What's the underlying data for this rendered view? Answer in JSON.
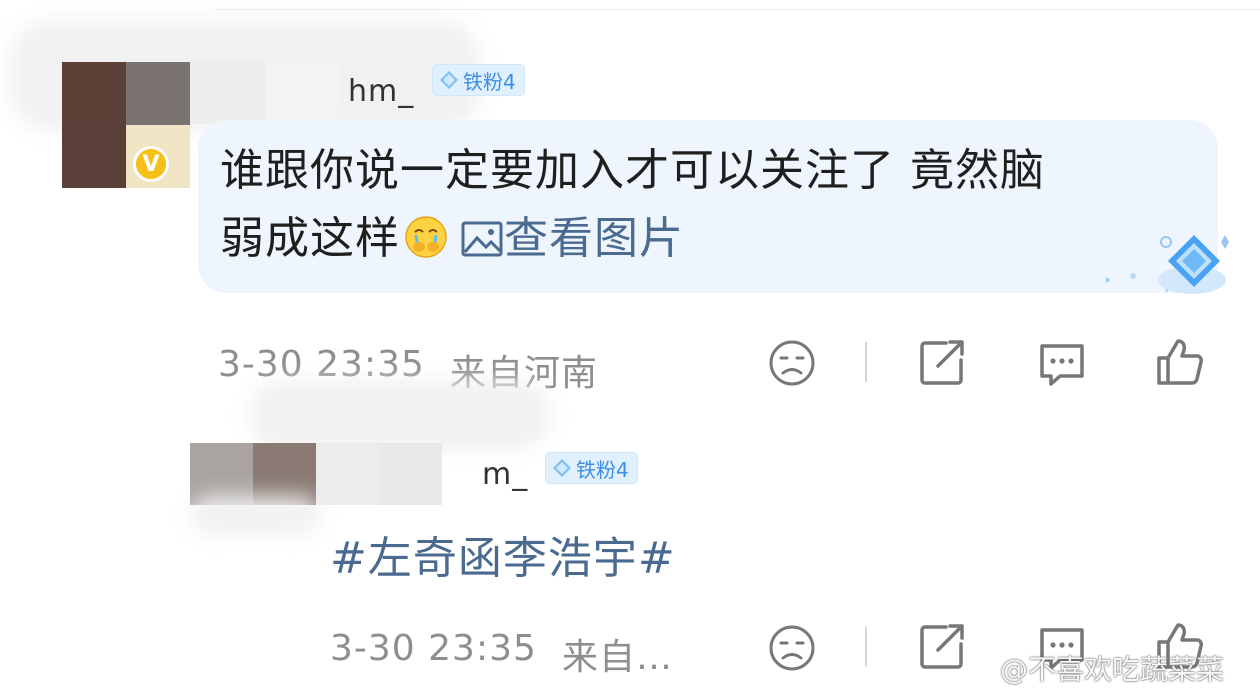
{
  "comment": {
    "name_partial": "hm_",
    "fan_badge": "铁粉4",
    "text_line1": "谁跟你说一定要加入才可以关注了 竟然脑",
    "text_line2": "弱成这样",
    "view_image": "查看图片",
    "time": "3-30 23:35",
    "location": "来自河南"
  },
  "reply": {
    "name_partial": "m_",
    "fan_badge": "铁粉4",
    "topic": "#左奇函李浩宇#",
    "time": "3-30 23:35",
    "location": "来自…"
  },
  "watermark": "@不喜欢吃蔬菜菜",
  "icons": [
    "verified-v-icon",
    "diamond-fan-icon",
    "dislike-face-icon",
    "share-icon",
    "comment-icon",
    "like-thumb-icon",
    "image-icon",
    "weibo-logo"
  ],
  "colors": {
    "bubble": "#eef5fd",
    "link": "#4a6a8f",
    "badge_text": "#3b8fe6",
    "meta": "#8e8e8e"
  }
}
